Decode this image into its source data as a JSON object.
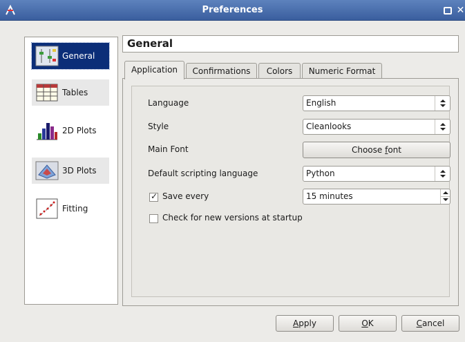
{
  "window": {
    "title": "Preferences"
  },
  "sidebar": {
    "items": [
      {
        "label": "General",
        "icon": "general-settings-icon",
        "selected": true
      },
      {
        "label": "Tables",
        "icon": "table-icon",
        "selected": false
      },
      {
        "label": "2D Plots",
        "icon": "bar-chart-icon",
        "selected": false
      },
      {
        "label": "3D Plots",
        "icon": "surface-plot-icon",
        "selected": false
      },
      {
        "label": "Fitting",
        "icon": "fitting-icon",
        "selected": false
      }
    ]
  },
  "header": {
    "title": "General"
  },
  "tabs": [
    {
      "label": "Application",
      "active": true
    },
    {
      "label": "Confirmations",
      "active": false
    },
    {
      "label": "Colors",
      "active": false
    },
    {
      "label": "Numeric Format",
      "active": false
    }
  ],
  "application": {
    "language": {
      "label": "Language",
      "value": "English"
    },
    "style": {
      "label": "Style",
      "value": "Cleanlooks"
    },
    "main_font": {
      "label": "Main Font",
      "button_pre": "Choose ",
      "button_accel": "f",
      "button_post": "ont"
    },
    "scripting": {
      "label": "Default scripting language",
      "value": "Python"
    },
    "save_every": {
      "label": "Save every",
      "checked": true,
      "value": "15 minutes"
    },
    "check_versions": {
      "label": "Check for new versions at startup",
      "checked": false
    }
  },
  "buttons": {
    "apply": {
      "accel": "A",
      "rest": "pply"
    },
    "ok": {
      "accel": "O",
      "rest": "K"
    },
    "cancel": {
      "accel": "C",
      "rest": "ancel"
    }
  },
  "colors": {
    "titlebar": "#3a5e9e",
    "selection": "#0b2e78"
  }
}
